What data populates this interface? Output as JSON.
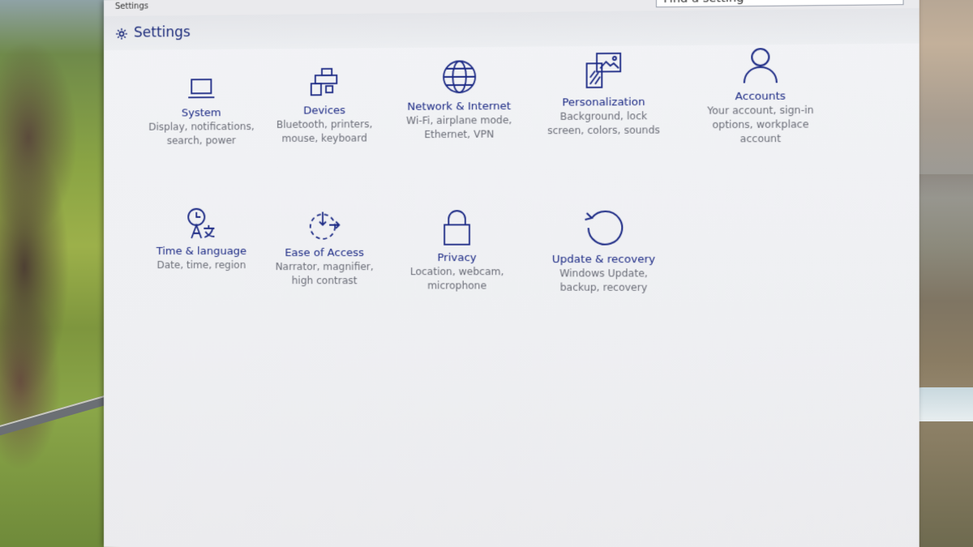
{
  "window": {
    "titlebar_text": "Settings",
    "header_title": "Settings",
    "search_placeholder": "Find a setting"
  },
  "colors": {
    "accent": "#1c2a85",
    "description": "#6b6e78",
    "window_bg": "#eeeff2"
  },
  "tiles": [
    {
      "label": "System",
      "desc": [
        "Display, notifications,",
        "search, power"
      ],
      "icon": "laptop-icon"
    },
    {
      "label": "Devices",
      "desc": [
        "Bluetooth, printers,",
        "mouse, keyboard"
      ],
      "icon": "devices-icon"
    },
    {
      "label": "Network & Internet",
      "desc": [
        "Wi-Fi, airplane mode,",
        "Ethernet, VPN"
      ],
      "icon": "globe-icon"
    },
    {
      "label": "Personalization",
      "desc": [
        "Background, lock",
        "screen, colors, sounds"
      ],
      "icon": "personalization-icon"
    },
    {
      "label": "Accounts",
      "desc": [
        "Your account, sign-in",
        "options, workplace",
        "account"
      ],
      "icon": "person-icon"
    },
    {
      "label": "Time & language",
      "desc": [
        "Date, time, region"
      ],
      "icon": "time-language-icon"
    },
    {
      "label": "Ease of Access",
      "desc": [
        "Narrator, magnifier,",
        "high contrast"
      ],
      "icon": "ease-of-access-icon"
    },
    {
      "label": "Privacy",
      "desc": [
        "Location, webcam,",
        "microphone"
      ],
      "icon": "lock-icon"
    },
    {
      "label": "Update & recovery",
      "desc": [
        "Windows Update,",
        "backup, recovery"
      ],
      "icon": "update-icon"
    }
  ]
}
